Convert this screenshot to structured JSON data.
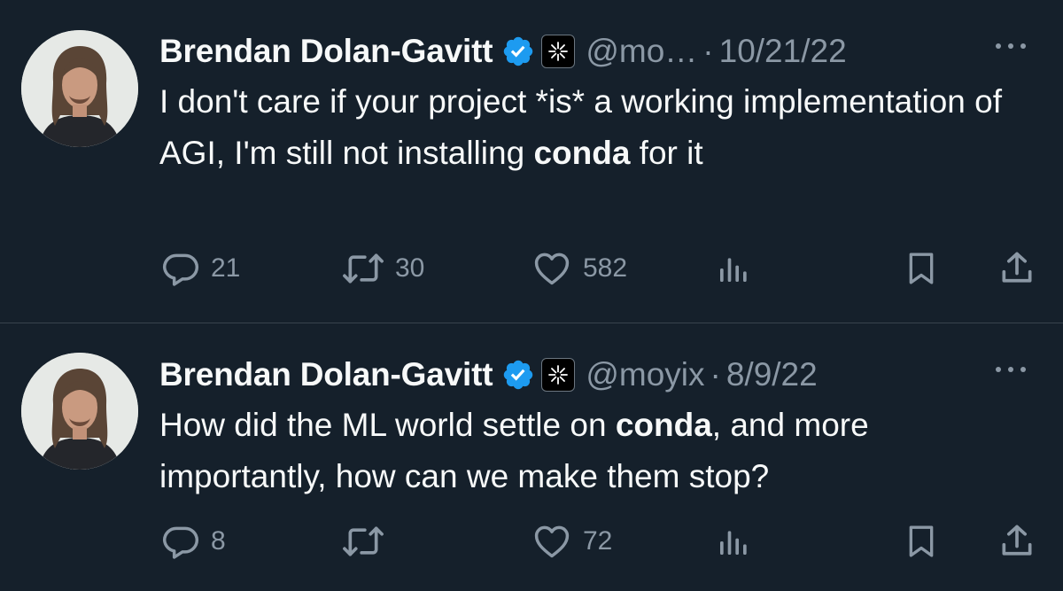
{
  "colors": {
    "background": "#15202b",
    "text": "#f7f9f9",
    "muted": "#8b98a5",
    "verified": "#1d9bf0",
    "divider": "#38444d"
  },
  "tweets": [
    {
      "author_name": "Brendan Dolan-Gavitt",
      "handle": "@mo…",
      "separator": "·",
      "date": "10/21/22",
      "text_parts": [
        "I don't care if your project *is* a working implementation of AGI, I'm still not installing ",
        "conda",
        " for it"
      ],
      "replies": "21",
      "retweets": "30",
      "likes": "582",
      "icons": [
        "reply-icon",
        "retweet-icon",
        "like-icon",
        "views-icon",
        "bookmark-icon",
        "share-icon"
      ]
    },
    {
      "author_name": "Brendan Dolan-Gavitt",
      "handle": "@moyix",
      "separator": "·",
      "date": "8/9/22",
      "text_parts": [
        "How did the ML world settle on ",
        "conda",
        ", and more importantly, how can we make them stop?"
      ],
      "replies": "8",
      "retweets": "",
      "likes": "72",
      "icons": [
        "reply-icon",
        "retweet-icon",
        "like-icon",
        "views-icon",
        "bookmark-icon",
        "share-icon"
      ]
    }
  ]
}
